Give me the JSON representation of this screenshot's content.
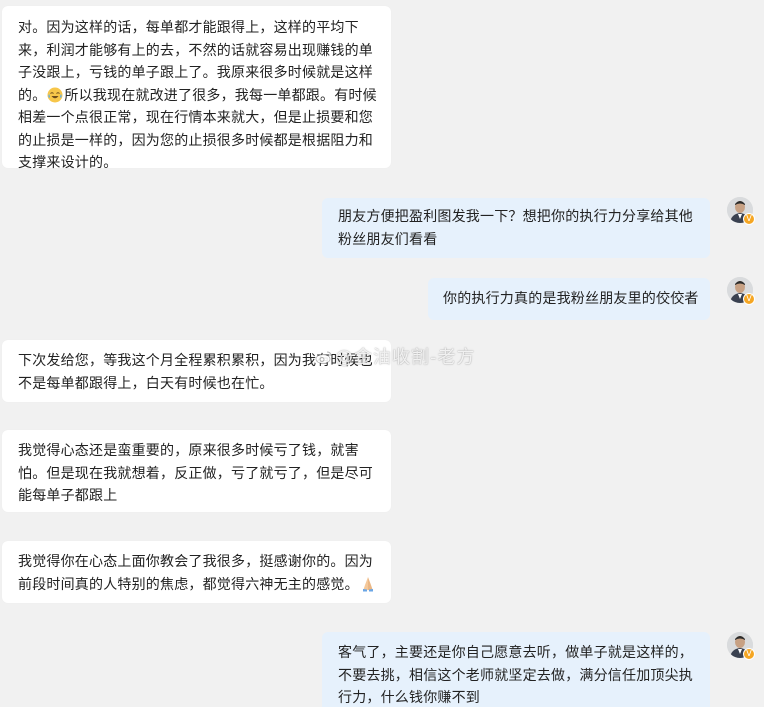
{
  "messages": [
    {
      "side": "left",
      "lines": [
        "对。因为这样的话，每单都才能跟得上，这样的平均下",
        "来，利润才能够有上的去，不然的话就容易出现赚钱的单",
        "子没跟上，亏钱的单子跟上了。我原来很多时候就是这样",
        "的。",
        "所以我现在就改进了很多，我每一单都跟。有时候",
        "相差一个点很正常，现在行情本来就大，但是止损要和您",
        "的止损是一样的，因为您的止损很多时候都是根据阻力和",
        "支撑来设计的。"
      ]
    },
    {
      "side": "right",
      "lines": [
        "朋友方便把盈利图发我一下？想把你的执行力分享给其他",
        "粉丝朋友们看看"
      ]
    },
    {
      "side": "right",
      "lines": [
        "你的执行力真的是我粉丝朋友里的佼佼者"
      ]
    },
    {
      "side": "left",
      "lines": [
        "下次发给您，等我这个月全程累积累积，因为我有时候也",
        "不是每单都跟得上，白天有时候也在忙。"
      ]
    },
    {
      "side": "left",
      "lines": [
        "我觉得心态还是蛮重要的，原来很多时候亏了钱，就害",
        "怕。但是现在我就想着，反正做，亏了就亏了，但是尽可",
        "能每单子都跟上"
      ]
    },
    {
      "side": "left",
      "lines": [
        "我觉得你在心态上面你教会了我很多，挺感谢你的。因为",
        "前段时间真的人特别的焦虑，都觉得六神无主的感觉。"
      ]
    },
    {
      "side": "right",
      "lines": [
        "客气了，主要还是你自己愿意去听，做单子就是这样的，",
        "不要去挑，相信这个老师就坚定去做，满分信任加顶尖执",
        "行力，什么钱你赚不到"
      ]
    }
  ],
  "emojis": {
    "m0": "crying-laughing-emoji",
    "m5": "praying-hands-emoji"
  },
  "avatar_badge": "V",
  "watermark": "@金油收割-老方",
  "colors": {
    "background": "#f1f1f1",
    "incoming_bubble": "#ffffff",
    "outgoing_bubble": "#e6f1fc",
    "text": "#222222",
    "badge": "#f5a623"
  }
}
